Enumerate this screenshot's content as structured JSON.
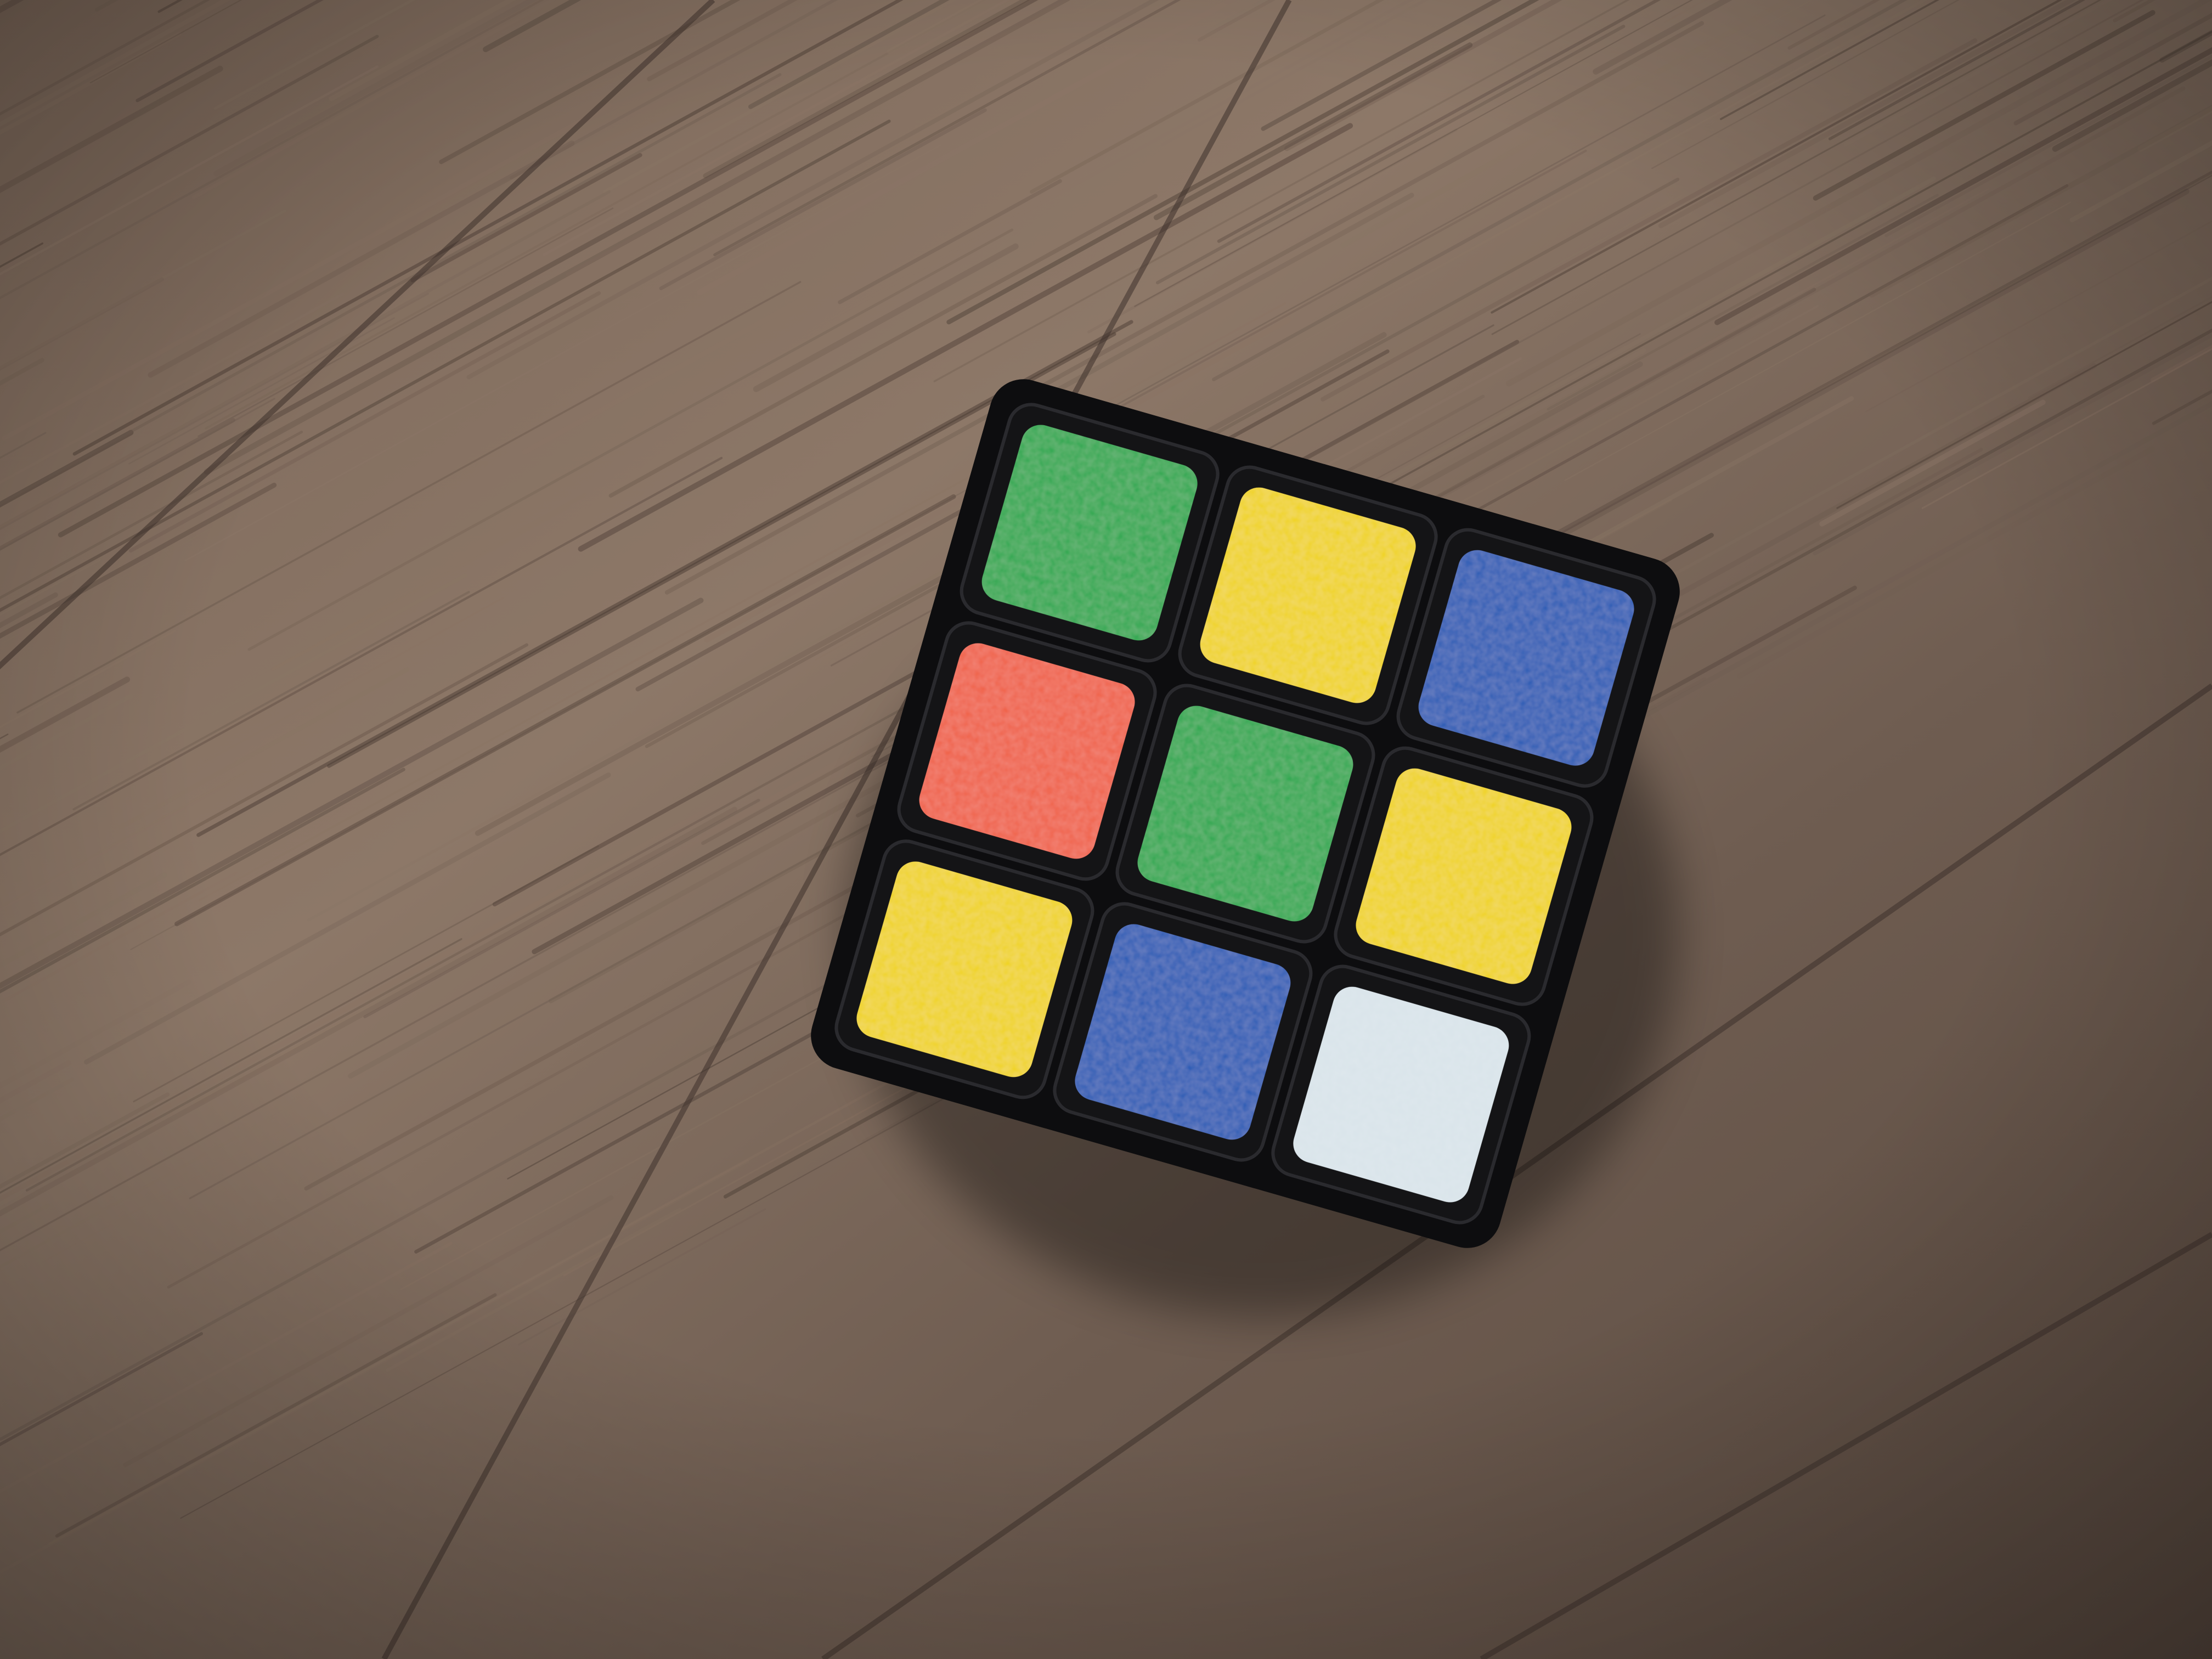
{
  "scene": {
    "subject": "rubiks-cube-3x3",
    "surface": "wood-floor",
    "colors": {
      "wood_light": "#8a7565",
      "wood_mid": "#6e5c50",
      "wood_dark": "#4a3c34",
      "cube_body": "#0d0d0f",
      "green": "#2fa84f",
      "yellow": "#f0d31a",
      "blue": "#2a5bb5",
      "red": "#f0624a",
      "white": "#d9e4ea"
    },
    "stickers": [
      {
        "row": 0,
        "col": 0,
        "color": "green"
      },
      {
        "row": 0,
        "col": 1,
        "color": "yellow"
      },
      {
        "row": 0,
        "col": 2,
        "color": "blue"
      },
      {
        "row": 1,
        "col": 0,
        "color": "red"
      },
      {
        "row": 1,
        "col": 1,
        "color": "green"
      },
      {
        "row": 1,
        "col": 2,
        "color": "yellow"
      },
      {
        "row": 2,
        "col": 0,
        "color": "yellow"
      },
      {
        "row": 2,
        "col": 1,
        "color": "blue"
      },
      {
        "row": 2,
        "col": 2,
        "color": "white"
      }
    ]
  }
}
